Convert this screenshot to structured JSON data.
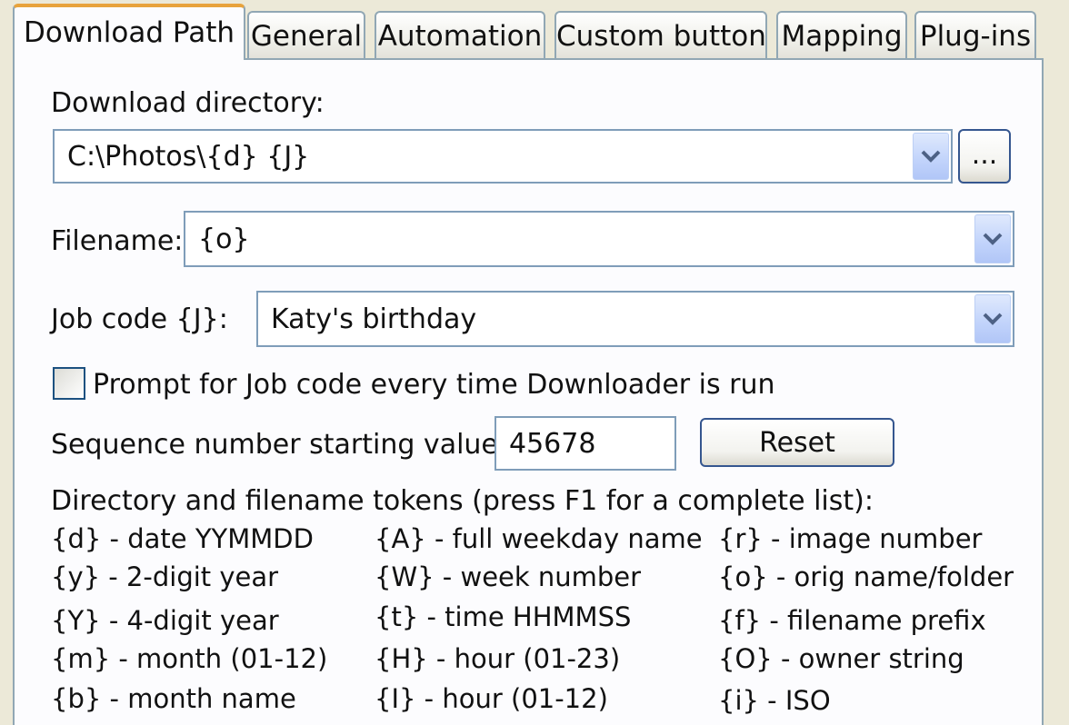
{
  "tabs": [
    {
      "label": "Download Path",
      "active": true
    },
    {
      "label": "General",
      "active": false
    },
    {
      "label": "Automation",
      "active": false
    },
    {
      "label": "Custom button",
      "active": false
    },
    {
      "label": "Mapping",
      "active": false
    },
    {
      "label": "Plug-ins",
      "active": false
    }
  ],
  "download_directory": {
    "label": "Download directory:",
    "value": "C:\\Photos\\{d} {J}",
    "browse_label": "..."
  },
  "filename": {
    "label": "Filename:",
    "value": "{o}"
  },
  "job_code": {
    "label": "Job code {J}:",
    "value": "Katy's birthday"
  },
  "prompt_checkbox": {
    "label": "Prompt for Job code every time Downloader is run",
    "checked": false
  },
  "sequence": {
    "label": "Sequence number starting value:",
    "value": "45678",
    "reset_label": "Reset"
  },
  "tokens": {
    "heading": "Directory and filename tokens (press F1 for a complete list):",
    "col1": [
      "{d} - date YYMMDD",
      "{y} - 2-digit year",
      "{Y} - 4-digit year",
      "{m} - month (01-12)",
      "{b} - month name"
    ],
    "col2": [
      "{A} - full weekday name",
      "{W} - week number",
      "{t} - time HHMMSS",
      "{H} - hour (01-23)",
      "{I} - hour (01-12)"
    ],
    "col3": [
      "{r} - image number",
      "{o} - orig name/folder",
      "{f} - filename prefix",
      "{O} - owner string",
      "{i} - ISO"
    ]
  },
  "colors": {
    "active_tab_accent": "#e8a33c",
    "border": "#91a7b4",
    "field_border": "#7f9db9",
    "button_border": "#35568f"
  }
}
